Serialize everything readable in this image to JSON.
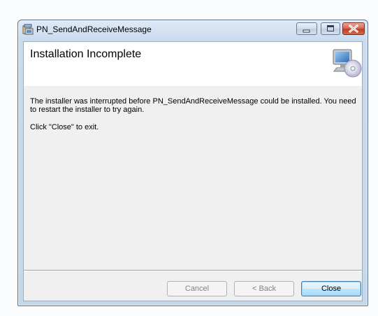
{
  "window": {
    "title": "PN_SendAndReceiveMessage",
    "controls": {
      "minimize_icon": "minimize-icon",
      "maximize_icon": "maximize-icon",
      "close_icon": "close-icon"
    }
  },
  "banner": {
    "title": "Installation Incomplete",
    "icon": "computer-cd-icon"
  },
  "body": {
    "message": "The installer was interrupted before PN_SendAndReceiveMessage could be installed. You need to restart the installer to try again.",
    "exit_instruction": "Click \"Close\" to exit."
  },
  "buttons": {
    "cancel": "Cancel",
    "back": "< Back",
    "close": "Close"
  },
  "colors": {
    "close_accent": "#c23d22",
    "default_button_border": "#3c7fb1",
    "disabled_text": "#838383"
  }
}
